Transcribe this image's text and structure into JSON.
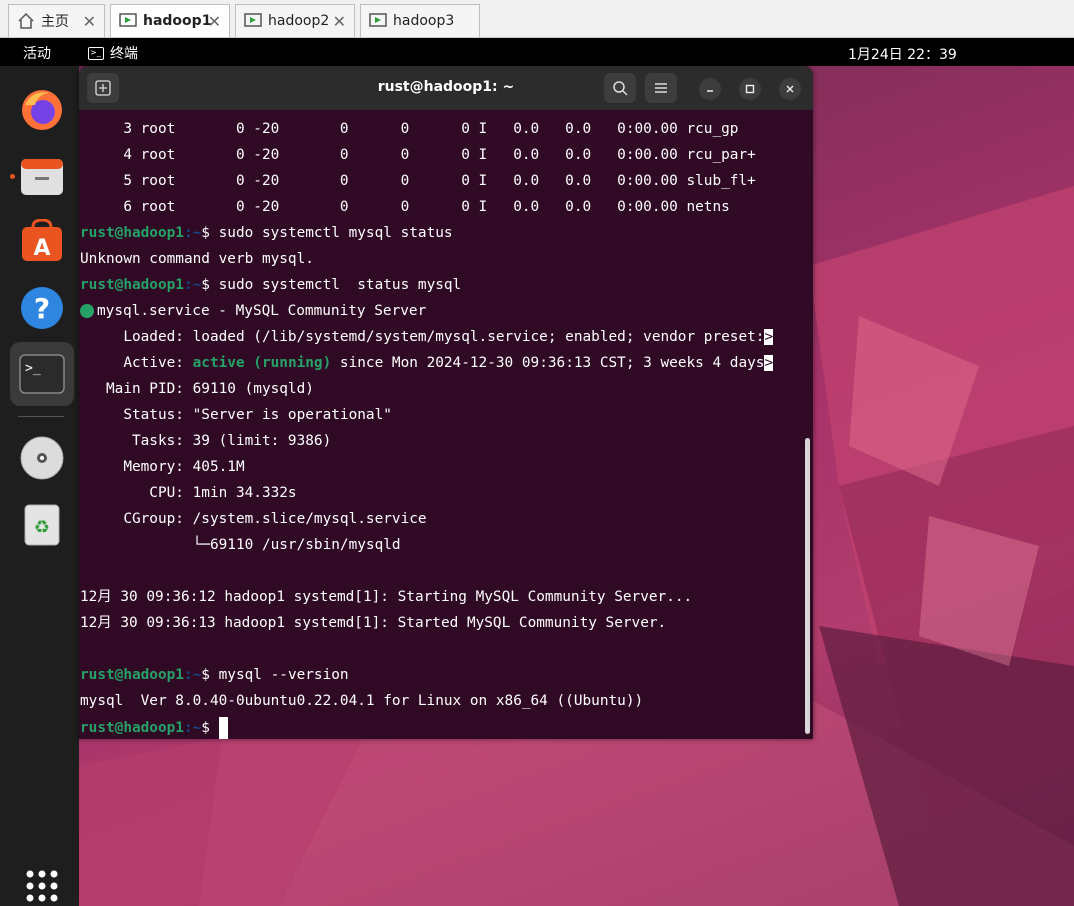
{
  "vm_tabs": [
    {
      "label": "主页",
      "active": false
    },
    {
      "label": "hadoop1",
      "active": true
    },
    {
      "label": "hadoop2",
      "active": false
    },
    {
      "label": "hadoop3",
      "active": false
    }
  ],
  "top_panel": {
    "activities": "活动",
    "app_name": "终端",
    "clock": "1月24日  22：39"
  },
  "dock": {
    "items": [
      "firefox-icon",
      "files-icon",
      "app-center-icon",
      "help-icon",
      "terminal-icon",
      "disc-icon",
      "trash-icon",
      "show-apps-icon"
    ]
  },
  "terminal": {
    "title": "rust@hadoop1: ~",
    "prompt_user": "rust@hadoop1",
    "prompt_path": ":~",
    "prompt_symbol": "$",
    "lines": {
      "l1": "     3 root       0 -20       0      0      0 I   0.0   0.0   0:00.00 rcu_gp",
      "l2": "     4 root       0 -20       0      0      0 I   0.0   0.0   0:00.00 rcu_par+",
      "l3": "     5 root       0 -20       0      0      0 I   0.0   0.0   0:00.00 slub_fl+",
      "l4": "     6 root       0 -20       0      0      0 I   0.0   0.0   0:00.00 netns",
      "cmd1": " sudo systemctl mysql status",
      "out1": "Unknown command verb mysql.",
      "cmd2": " sudo systemctl  status mysql",
      "service": "mysql.service - MySQL Community Server",
      "loaded": "     Loaded: loaded (/lib/systemd/system/mysql.service; enabled; vendor preset:",
      "active_label": "     Active: ",
      "active_state": "active (running)",
      "active_rest": " since Mon 2024-12-30 09:36:13 CST; 3 weeks 4 days",
      "trunc_marker": ">",
      "mainpid": "   Main PID: 69110 (mysqld)",
      "status": "     Status: \"Server is operational\"",
      "tasks": "      Tasks: 39 (limit: 9386)",
      "memory": "     Memory: 405.1M",
      "cpu": "        CPU: 1min 34.332s",
      "cgroup": "     CGroup: /system.slice/mysql.service",
      "cgroup_child": "             └─69110 /usr/sbin/mysqld",
      "log1": "12月 30 09:36:12 hadoop1 systemd[1]: Starting MySQL Community Server...",
      "log2": "12月 30 09:36:13 hadoop1 systemd[1]: Started MySQL Community Server.",
      "cmd3": " mysql --version",
      "version": "mysql  Ver 8.0.40-0ubuntu0.22.04.1 for Linux on x86_64 ((Ubuntu))"
    }
  }
}
